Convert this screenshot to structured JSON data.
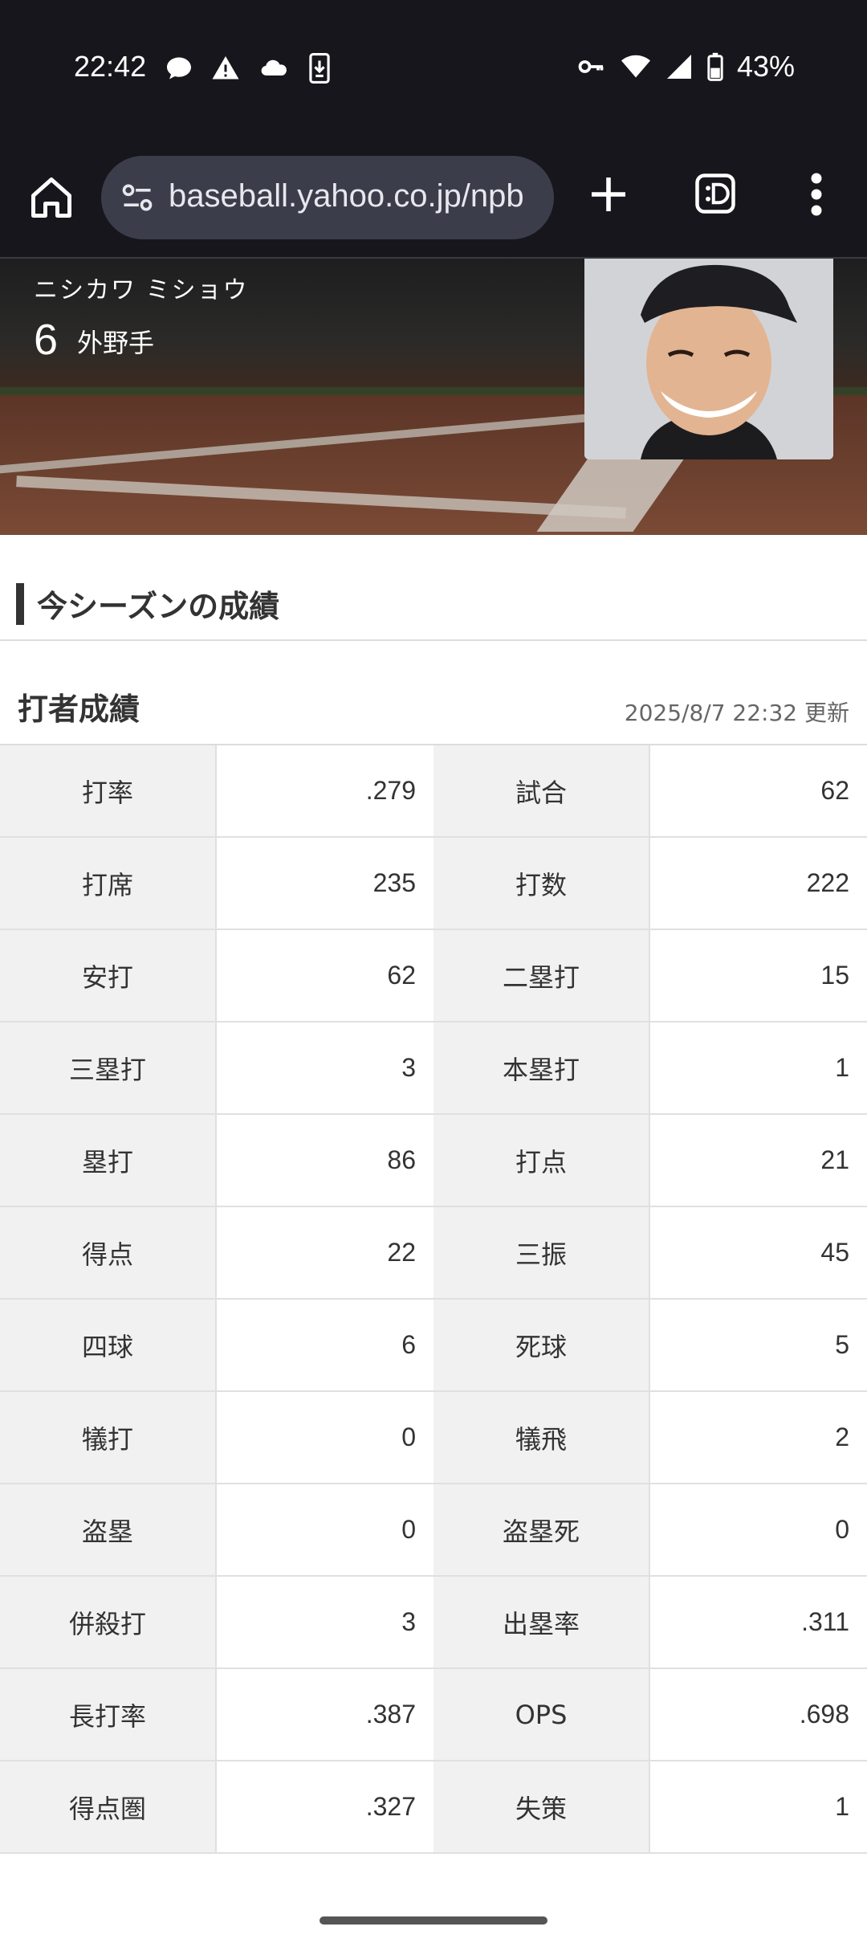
{
  "status_bar": {
    "time": "22:42",
    "battery_text": "43%"
  },
  "browser": {
    "url": "baseball.yahoo.co.jp/npb"
  },
  "player": {
    "name_kana": "ニシカワ ミショウ",
    "number": "6",
    "position": "外野手"
  },
  "section": {
    "title": "今シーズンの成績"
  },
  "batting": {
    "title": "打者成績",
    "updated": "2025/8/7 22:32 更新",
    "rows": [
      {
        "l1": "打率",
        "v1": ".279",
        "l2": "試合",
        "v2": "62"
      },
      {
        "l1": "打席",
        "v1": "235",
        "l2": "打数",
        "v2": "222"
      },
      {
        "l1": "安打",
        "v1": "62",
        "l2": "二塁打",
        "v2": "15"
      },
      {
        "l1": "三塁打",
        "v1": "3",
        "l2": "本塁打",
        "v2": "1"
      },
      {
        "l1": "塁打",
        "v1": "86",
        "l2": "打点",
        "v2": "21"
      },
      {
        "l1": "得点",
        "v1": "22",
        "l2": "三振",
        "v2": "45"
      },
      {
        "l1": "四球",
        "v1": "6",
        "l2": "死球",
        "v2": "5"
      },
      {
        "l1": "犠打",
        "v1": "0",
        "l2": "犠飛",
        "v2": "2"
      },
      {
        "l1": "盗塁",
        "v1": "0",
        "l2": "盗塁死",
        "v2": "0"
      },
      {
        "l1": "併殺打",
        "v1": "3",
        "l2": "出塁率",
        "v2": ".311"
      },
      {
        "l1": "長打率",
        "v1": ".387",
        "l2": "OPS",
        "v2": ".698"
      },
      {
        "l1": "得点圏",
        "v1": ".327",
        "l2": "失策",
        "v2": "1"
      }
    ]
  }
}
